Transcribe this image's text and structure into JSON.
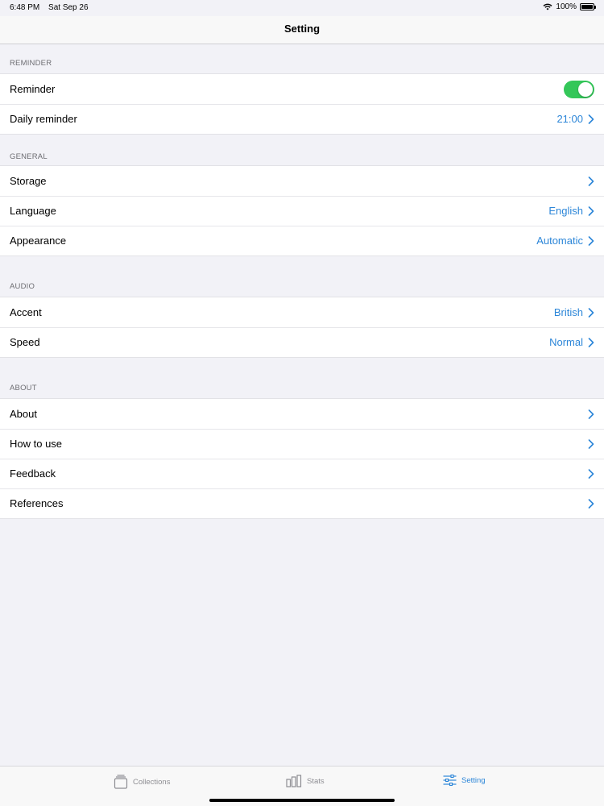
{
  "status": {
    "time": "6:48 PM",
    "date": "Sat Sep 26",
    "battery": "100%"
  },
  "nav": {
    "title": "Setting"
  },
  "sections": {
    "reminder": {
      "header": "REMINDER",
      "reminder_label": "Reminder",
      "reminder_on": true,
      "daily_label": "Daily reminder",
      "daily_value": "21:00"
    },
    "general": {
      "header": "GENERAL",
      "storage_label": "Storage",
      "language_label": "Language",
      "language_value": "English",
      "appearance_label": "Appearance",
      "appearance_value": "Automatic"
    },
    "audio": {
      "header": "AUDIO",
      "accent_label": "Accent",
      "accent_value": "British",
      "speed_label": "Speed",
      "speed_value": "Normal"
    },
    "about": {
      "header": "ABOUT",
      "about_label": "About",
      "howto_label": "How to use",
      "feedback_label": "Feedback",
      "references_label": "References"
    }
  },
  "tabs": [
    {
      "label": "Collections",
      "icon": "collections-icon",
      "active": false
    },
    {
      "label": "Stats",
      "icon": "stats-icon",
      "active": false
    },
    {
      "label": "Setting",
      "icon": "sliders-icon",
      "active": true
    }
  ],
  "colors": {
    "accent": "#2c86d8",
    "toggle_on": "#34c759",
    "background": "#f2f2f7"
  }
}
